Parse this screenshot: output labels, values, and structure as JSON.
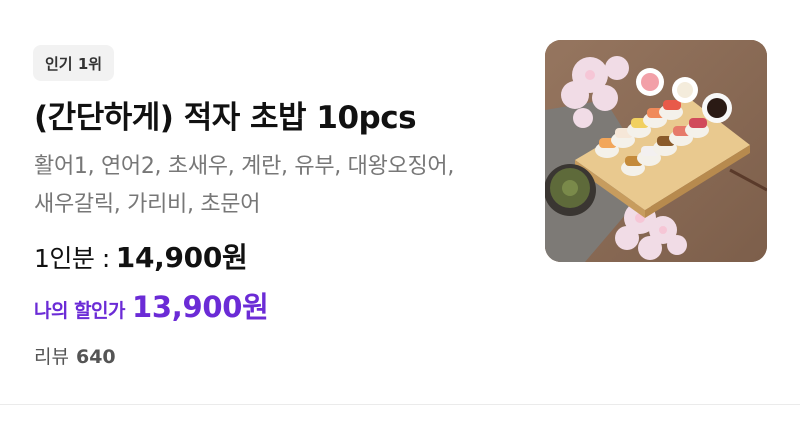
{
  "menu_item": {
    "badge": "인기 1위",
    "title": "(간단하게) 적자 초밥 10pcs",
    "description_line1": "활어1, 연어2, 초새우, 계란, 유부, 대왕오징어,",
    "description_line2": "새우갈릭, 가리비, 초문어",
    "price_label": "1인분 :",
    "price": "14,900원",
    "discount_label": "나의 할인가",
    "discount_price": "13,900원",
    "review_label": "리뷰",
    "review_count": "640",
    "image_icon": "sushi-photo",
    "add_icon": "plus-icon"
  },
  "colors": {
    "accent_purple": "#6b2bd6",
    "badge_bg": "#f2f2f2",
    "description_gray": "#777777"
  }
}
